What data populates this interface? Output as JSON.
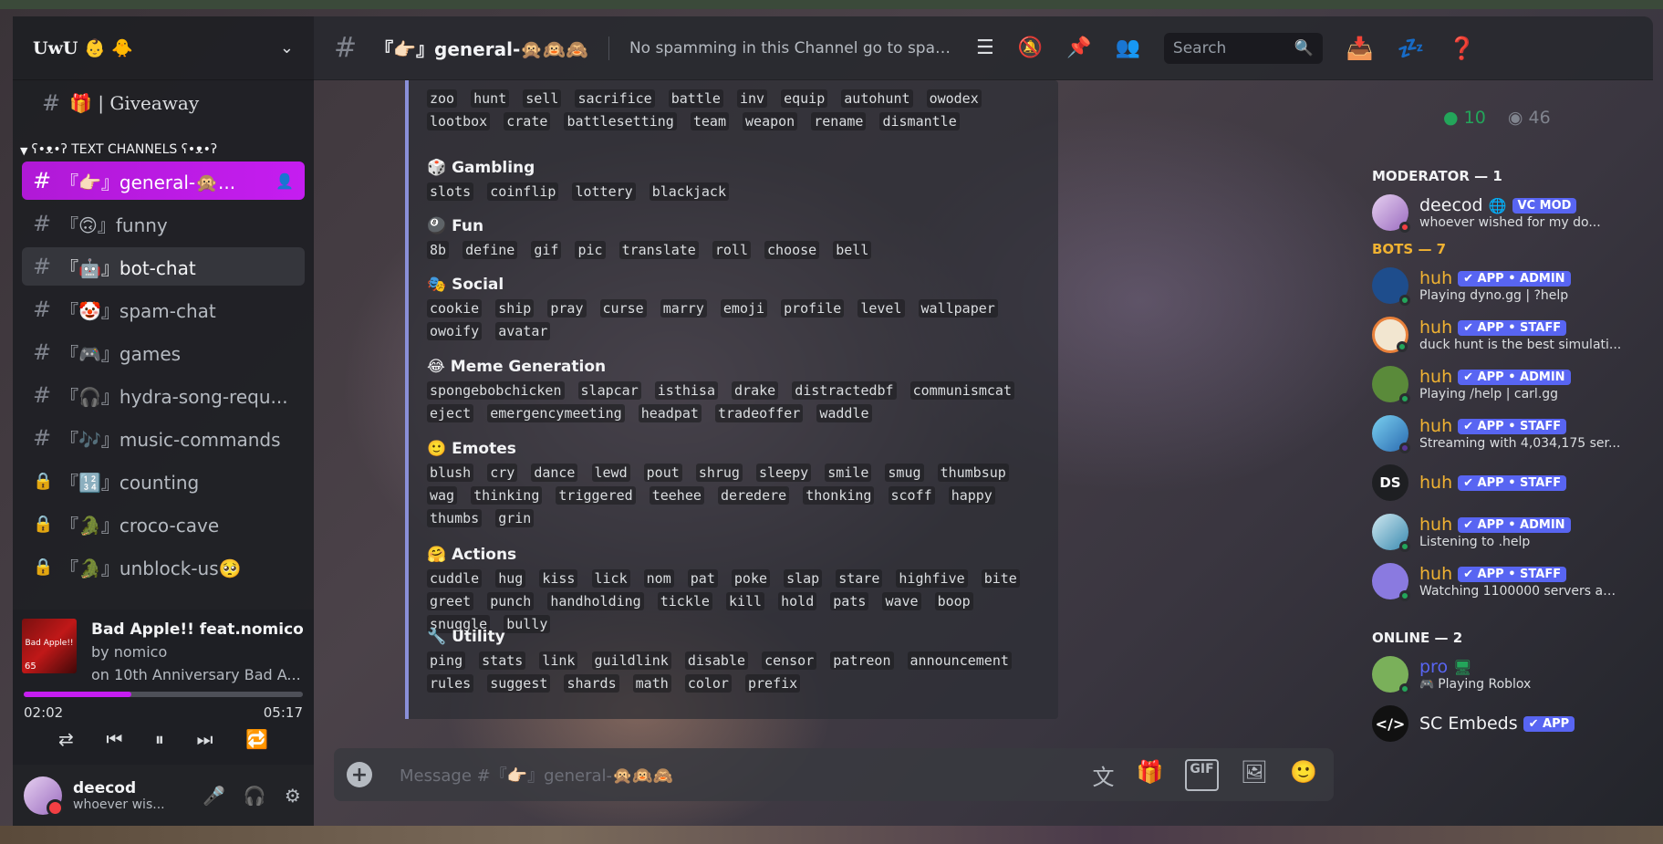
{
  "server": {
    "name": "UwU 👶 🐥"
  },
  "sidebar": {
    "giveaway": "🎁 | Giveaway",
    "category": "ʕ•ᴥ•ʔ TEXT CHANNELS ʕ•ᴥ•ʔ",
    "channels": [
      {
        "name": "『👉🏻』general-🙊...",
        "icon": "#"
      },
      {
        "name": "『🙃』funny",
        "icon": "#"
      },
      {
        "name": "『🤖』bot-chat",
        "icon": "#"
      },
      {
        "name": "『🤡』spam-chat",
        "icon": "#"
      },
      {
        "name": "『🎮』games",
        "icon": "#"
      },
      {
        "name": "『🎧』hydra-song-requ...",
        "icon": "#"
      },
      {
        "name": "『🎶』music-commands",
        "icon": "#"
      },
      {
        "name": "『🔢』counting",
        "icon": "lock"
      },
      {
        "name": "『🐊』croco-cave",
        "icon": "lock"
      },
      {
        "name": "『🐊』unblock-us🥺",
        "icon": "lock"
      }
    ]
  },
  "music": {
    "album_text": "Bad Apple!!",
    "album_num": "65",
    "title": "Bad Apple!! feat.nomico",
    "by": "by nomico",
    "on": "on 10th Anniversary Bad A...",
    "elapsed": "02:02",
    "duration": "05:17",
    "progress": 0.385
  },
  "user": {
    "name": "deecod",
    "status": "whoever wis..."
  },
  "header": {
    "title": "『👉🏻』general-🙊🙉🙈",
    "topic": "No spamming in this Channel go to spam ...",
    "search_placeholder": "Search"
  },
  "message": {
    "sections": [
      {
        "title": "",
        "cmds": [
          "zoo",
          "hunt",
          "sell",
          "sacrifice",
          "battle",
          "inv",
          "equip",
          "autohunt",
          "owodex",
          "lootbox",
          "crate",
          "battlesetting",
          "team",
          "weapon",
          "rename",
          "dismantle"
        ]
      },
      {
        "title": "🎲 Gambling",
        "cmds": [
          "slots",
          "coinflip",
          "lottery",
          "blackjack"
        ]
      },
      {
        "title": "🎱 Fun",
        "cmds": [
          "8b",
          "define",
          "gif",
          "pic",
          "translate",
          "roll",
          "choose",
          "bell"
        ]
      },
      {
        "title": "🎭 Social",
        "cmds": [
          "cookie",
          "ship",
          "pray",
          "curse",
          "marry",
          "emoji",
          "profile",
          "level",
          "wallpaper",
          "owoify",
          "avatar"
        ]
      },
      {
        "title": "😂 Meme Generation",
        "cmds": [
          "spongebobchicken",
          "slapcar",
          "isthisa",
          "drake",
          "distractedbf",
          "communismcat",
          "eject",
          "emergencymeeting",
          "headpat",
          "tradeoffer",
          "waddle"
        ]
      },
      {
        "title": "🙂 Emotes",
        "cmds": [
          "blush",
          "cry",
          "dance",
          "lewd",
          "pout",
          "shrug",
          "sleepy",
          "smile",
          "smug",
          "thumbsup",
          "wag",
          "thinking",
          "triggered",
          "teehee",
          "deredere",
          "thonking",
          "scoff",
          "happy",
          "thumbs",
          "grin"
        ]
      },
      {
        "title": "🤗 Actions",
        "cmds": [
          "cuddle",
          "hug",
          "kiss",
          "lick",
          "nom",
          "pat",
          "poke",
          "slap",
          "stare",
          "highfive",
          "bite",
          "greet",
          "punch",
          "handholding",
          "tickle",
          "kill",
          "hold",
          "pats",
          "wave",
          "boop",
          "snuggle",
          "bully"
        ]
      },
      {
        "title": "🔧 Utility",
        "cmds": [
          "ping",
          "stats",
          "link",
          "guildlink",
          "disable",
          "censor",
          "patreon",
          "announcement",
          "rules",
          "suggest",
          "shards",
          "math",
          "color",
          "prefix"
        ]
      }
    ]
  },
  "composer": {
    "placeholder": "Message #『👉🏻』general-🙊🙉🙈"
  },
  "members": {
    "online_count": "10",
    "offline_count": "46",
    "groups": {
      "moderator": "MODERATOR — 1",
      "bots": "BOTS — 7",
      "online": "ONLINE — 2"
    },
    "moderator": {
      "name": "deecod",
      "tag": "VC MOD",
      "status": "whoever wished for my do..."
    },
    "bots": [
      {
        "name": "huh",
        "tag": "✔ APP • ADMIN",
        "status": "Playing dyno.gg | ?help"
      },
      {
        "name": "huh",
        "tag": "✔ APP • STAFF",
        "status": "duck hunt is the best simulati..."
      },
      {
        "name": "huh",
        "tag": "✔ APP • ADMIN",
        "status": "Playing /help | carl.gg"
      },
      {
        "name": "huh",
        "tag": "✔ APP • STAFF",
        "status": "Streaming with 4,034,175 ser..."
      },
      {
        "name": "huh",
        "tag": "✔ APP • STAFF",
        "status": ""
      },
      {
        "name": "huh",
        "tag": "✔ APP • ADMIN",
        "status": "Listening to .help"
      },
      {
        "name": "huh",
        "tag": "✔ APP • STAFF",
        "status": "Watching 1100000 servers an..."
      }
    ],
    "online": [
      {
        "name": "pro",
        "status": "Playing Roblox"
      },
      {
        "name": "SC Embeds",
        "tag": "✔ APP"
      }
    ]
  },
  "colors": {
    "accent": "#c51df0",
    "online": "#23a55a",
    "dnd": "#f23f43",
    "bot_name": "#f0b232",
    "tag": "#5865f2"
  }
}
